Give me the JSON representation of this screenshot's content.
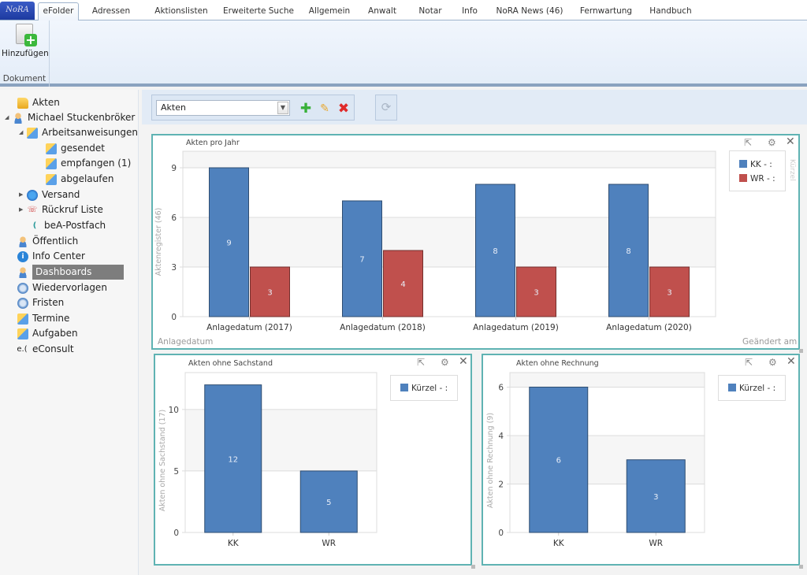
{
  "app": {
    "logo_text": "NoRA"
  },
  "tabs": [
    {
      "label": "eFolder",
      "active": true
    },
    {
      "label": "Adressen"
    },
    {
      "label": "Aktionslisten"
    },
    {
      "label": "Erweiterte Suche"
    },
    {
      "label": "Allgemein"
    },
    {
      "label": "Anwalt"
    },
    {
      "label": "Notar"
    },
    {
      "label": "Info"
    },
    {
      "label": "NoRA News (46)"
    },
    {
      "label": "Fernwartung"
    },
    {
      "label": "Handbuch"
    }
  ],
  "ribbon": {
    "add_button_label": "Hinzufügen",
    "group_label": "Dokument"
  },
  "sidebar": {
    "items": [
      {
        "label": "Akten",
        "icon": "folder-icon",
        "level": 0
      },
      {
        "label": "Michael Stuckenbröker",
        "icon": "user-icon",
        "level": 0,
        "expanded": true
      },
      {
        "label": "Arbeitsanweisungen",
        "icon": "notes-icon",
        "level": 1,
        "expanded": true
      },
      {
        "label": "gesendet",
        "icon": "notes-icon",
        "level": 2
      },
      {
        "label": "empfangen (1)",
        "icon": "notes-icon",
        "level": 2
      },
      {
        "label": "abgelaufen",
        "icon": "notes-icon",
        "level": 2
      },
      {
        "label": "Versand",
        "icon": "globe-icon",
        "level": 1,
        "expanded": false
      },
      {
        "label": "Rückruf Liste",
        "icon": "phone-icon",
        "level": 1,
        "expanded": false
      },
      {
        "label": "beA-Postfach",
        "icon": "bea-icon",
        "level": 1
      },
      {
        "label": "Öffentlich",
        "icon": "user-icon",
        "level": 0
      },
      {
        "label": "Info Center",
        "icon": "info-icon",
        "level": 0
      },
      {
        "label": "Dashboards",
        "icon": "user-icon",
        "level": 0,
        "selected": true
      },
      {
        "label": "Wiedervorlagen",
        "icon": "clock-icon",
        "level": 0
      },
      {
        "label": "Fristen",
        "icon": "clock-icon",
        "level": 0
      },
      {
        "label": "Termine",
        "icon": "notes-icon",
        "level": 0
      },
      {
        "label": "Aufgaben",
        "icon": "notes-icon",
        "level": 0
      },
      {
        "label": "eConsult",
        "icon": "econsult-icon",
        "level": 0
      }
    ]
  },
  "dashboard_toolbar": {
    "selected_dashboard": "Akten"
  },
  "colors": {
    "series_blue": "#4f81bd",
    "series_red": "#c0504d",
    "widget_border": "#5fb3b3"
  },
  "widgets": {
    "akten_pro_jahr": {
      "title": "Akten pro Jahr",
      "footer_left": "Anlagedatum",
      "footer_right": "Geändert am",
      "legend_side_label": "Kürzel"
    },
    "ohne_sachstand": {
      "title": "Akten ohne Sachstand"
    },
    "ohne_rechnung": {
      "title": "Akten ohne Rechnung"
    }
  },
  "chart_data": [
    {
      "id": "akten_pro_jahr",
      "type": "bar",
      "title": "Akten pro Jahr",
      "categories": [
        "Anlagedatum (2017)",
        "Anlagedatum (2018)",
        "Anlagedatum (2019)",
        "Anlagedatum (2020)"
      ],
      "series": [
        {
          "name": "KK - :",
          "color": "#4f81bd",
          "values": [
            9,
            7,
            8,
            8
          ]
        },
        {
          "name": "WR - :",
          "color": "#c0504d",
          "values": [
            3,
            4,
            3,
            3
          ]
        }
      ],
      "xlabel": "Anlagedatum",
      "ylabel": "Aktenregister  (46)",
      "ylim": [
        0,
        10
      ],
      "yticks": [
        0,
        3,
        6,
        9
      ],
      "grid": true,
      "legend": "right"
    },
    {
      "id": "ohne_sachstand",
      "type": "bar",
      "title": "Akten ohne Sachstand",
      "categories": [
        "KK",
        "WR"
      ],
      "series": [
        {
          "name": "Kürzel - :",
          "color": "#4f81bd",
          "values": [
            12,
            5
          ]
        }
      ],
      "ylabel": "Akten ohne Sachstand  (17)",
      "ylim": [
        0,
        13
      ],
      "yticks": [
        0,
        5,
        10
      ],
      "grid": true,
      "legend": "right"
    },
    {
      "id": "ohne_rechnung",
      "type": "bar",
      "title": "Akten ohne Rechnung",
      "categories": [
        "KK",
        "WR"
      ],
      "series": [
        {
          "name": "Kürzel - :",
          "color": "#4f81bd",
          "values": [
            6,
            3
          ]
        }
      ],
      "ylabel": "Akten ohne Rechnung  (9)",
      "ylim": [
        0,
        6.6
      ],
      "yticks": [
        0,
        2,
        4,
        6
      ],
      "grid": true,
      "legend": "right"
    }
  ]
}
